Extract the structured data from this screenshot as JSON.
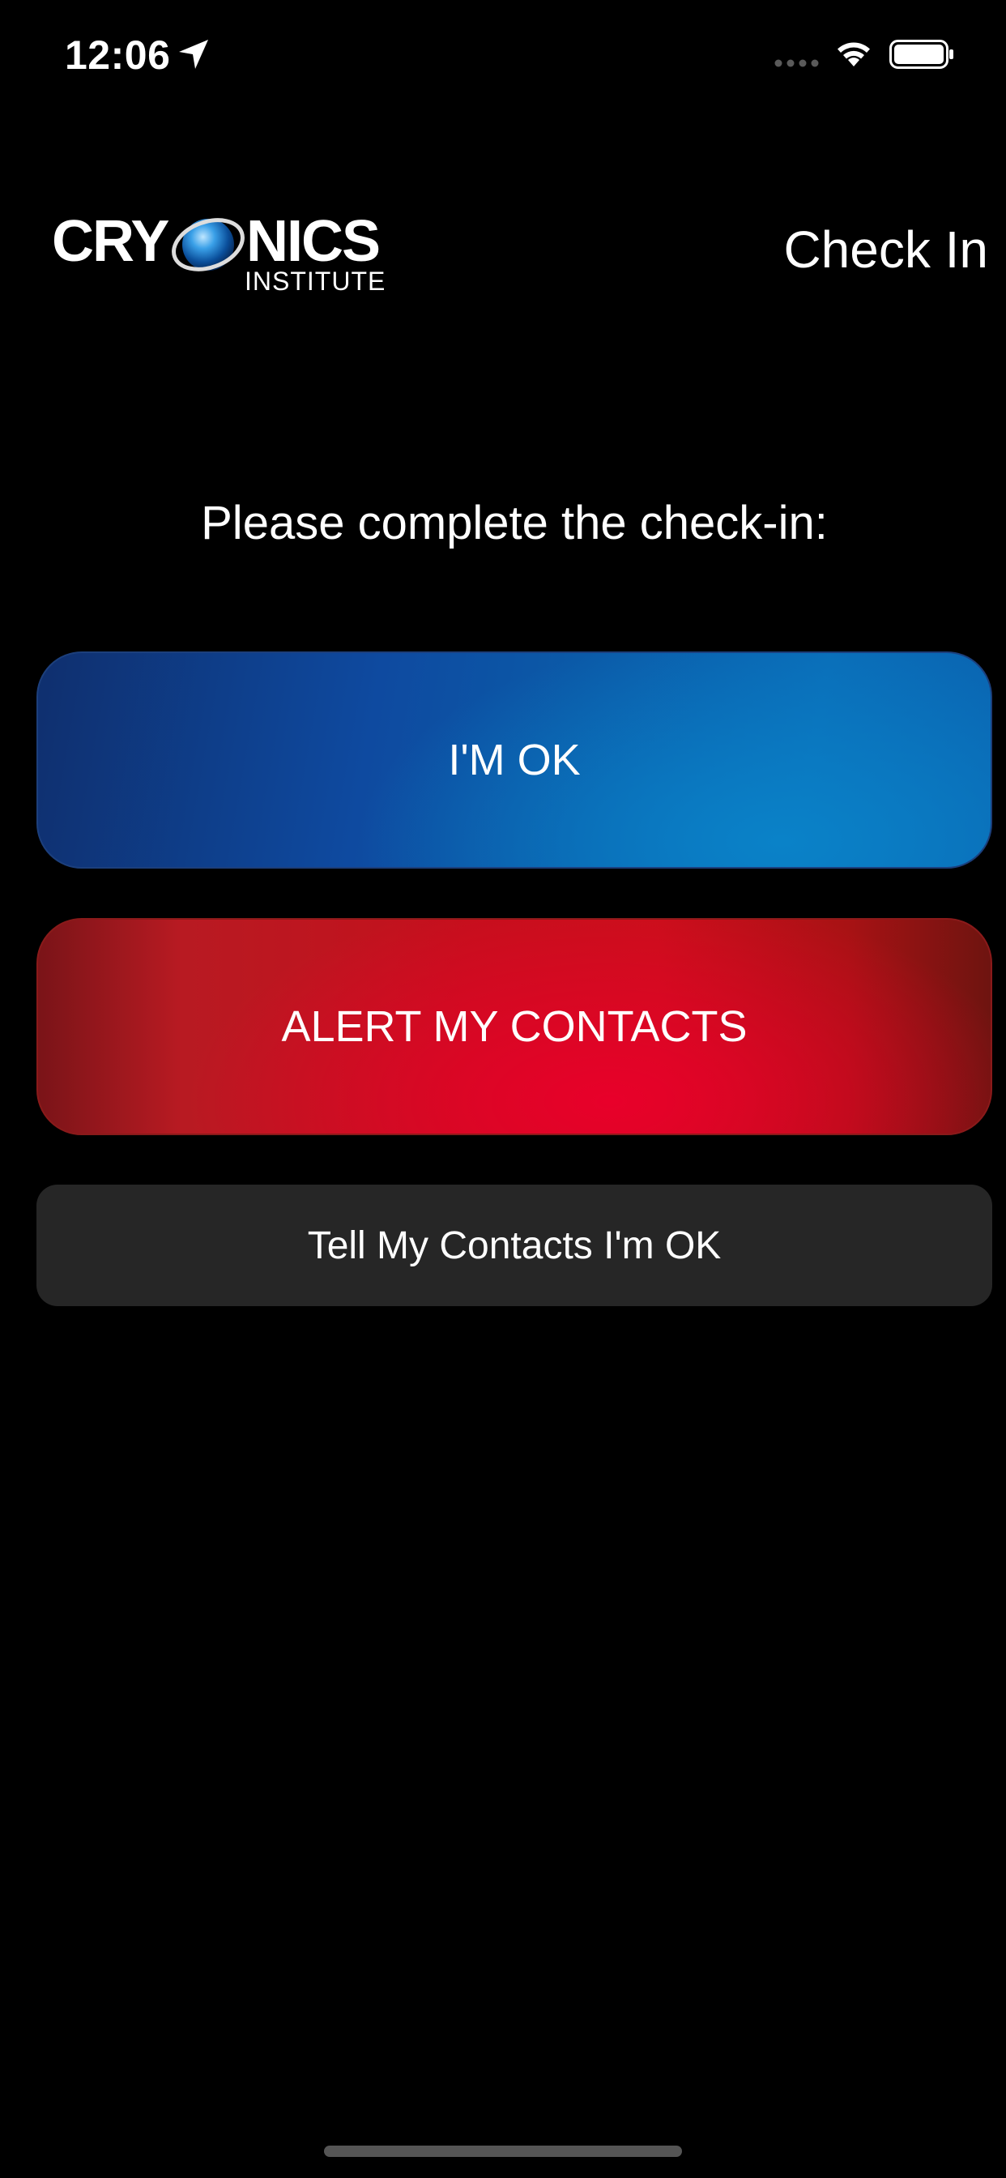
{
  "status_bar": {
    "time": "12:06",
    "location_icon": "location-arrow-icon",
    "signal_icon": "cellular-signal-icon",
    "wifi_icon": "wifi-icon",
    "battery_icon": "battery-icon"
  },
  "header": {
    "logo": {
      "primary": "CRYONICS",
      "secondary": "INSTITUTE"
    },
    "title": "Check In"
  },
  "main": {
    "prompt": "Please complete the check-in:",
    "buttons": {
      "ok_label": "I'M OK",
      "alert_label": "ALERT MY CONTACTS",
      "tell_label": "Tell My Contacts I'm OK"
    }
  },
  "colors": {
    "background": "#000000",
    "ok_button": "#0b5aa8",
    "alert_button": "#c8101a",
    "tell_button": "#262626",
    "text": "#ffffff"
  }
}
